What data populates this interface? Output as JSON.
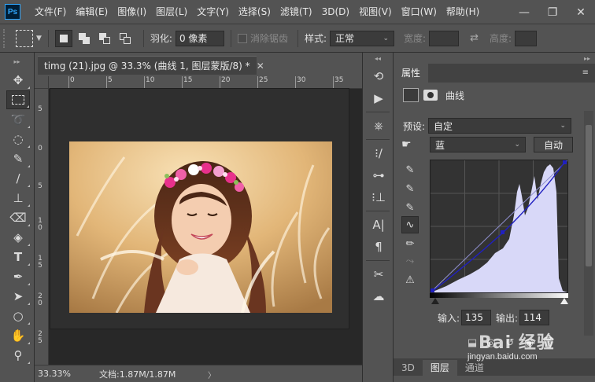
{
  "app": {
    "logo": "Ps"
  },
  "menu": [
    "文件(F)",
    "编辑(E)",
    "图像(I)",
    "图层(L)",
    "文字(Y)",
    "选择(S)",
    "滤镜(T)",
    "3D(D)",
    "视图(V)",
    "窗口(W)",
    "帮助(H)"
  ],
  "window_controls": {
    "minimize": "—",
    "restore": "❐",
    "close": "✕"
  },
  "options": {
    "feather_label": "羽化:",
    "feather_value": "0 像素",
    "antialias_label": "消除锯齿",
    "style_label": "样式:",
    "style_value": "正常",
    "width_label": "宽度:",
    "height_label": "高度:"
  },
  "document": {
    "tab_title": "timg (21).jpg @ 33.3% (曲线 1, 图层蒙版/8) *",
    "tab_close": "✕",
    "ruler_h": [
      "0",
      "5",
      "10",
      "15",
      "20",
      "25",
      "30",
      "35"
    ],
    "ruler_v": [
      "5",
      "0",
      "5",
      "1\n0",
      "1\n5",
      "2\n0",
      "2\n5"
    ],
    "zoom": "33.33%",
    "doc_info": "文档:1.87M/1.87M",
    "status_arrow": "〉"
  },
  "properties": {
    "tab": "属性",
    "menu_icon": "≡",
    "adjustment_name": "曲线",
    "preset_label": "预设:",
    "preset_value": "自定",
    "channel_value": "蓝",
    "auto_button": "自动",
    "input_label": "输入:",
    "input_value": "135",
    "output_label": "输出:",
    "output_value": "114"
  },
  "bottom_tabs": [
    "3D",
    "图层",
    "通道"
  ],
  "watermark": {
    "brand": "Bai 经验",
    "url": "jingyan.baidu.com"
  },
  "colors": {
    "accent": "#31a8ff",
    "histogram": "#d8d8f8",
    "curve": "#2020c0"
  }
}
